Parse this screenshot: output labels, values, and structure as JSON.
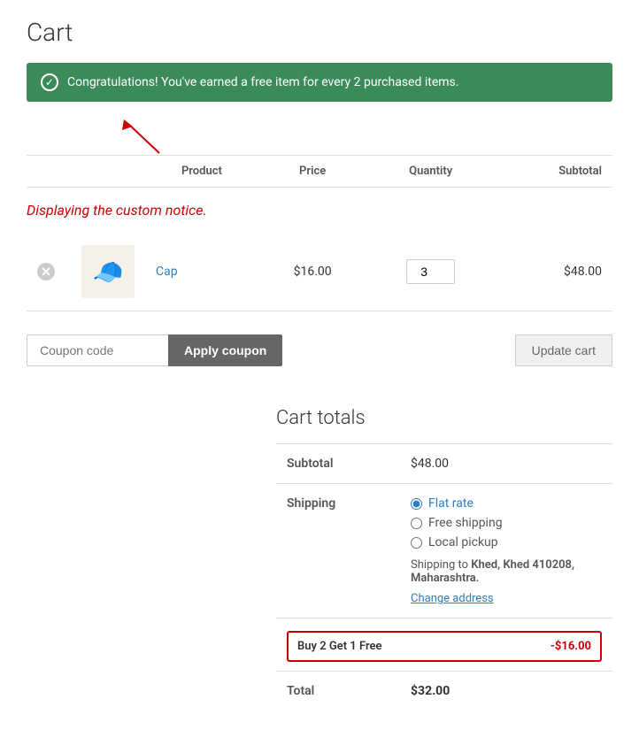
{
  "page": {
    "title": "Cart"
  },
  "notice": {
    "message": "Congratulations! You've earned a free item for every 2 purchased items.",
    "icon": "✓"
  },
  "custom_notice": "Displaying the custom notice.",
  "table": {
    "headers": [
      "",
      "",
      "Product",
      "Price",
      "Quantity",
      "Subtotal"
    ],
    "rows": [
      {
        "product_name": "Cap",
        "price": "$16.00",
        "quantity": 3,
        "subtotal": "$48.00",
        "thumb_emoji": "🧢"
      }
    ]
  },
  "coupon": {
    "placeholder": "Coupon code",
    "apply_label": "Apply coupon",
    "update_label": "Update cart"
  },
  "cart_totals": {
    "title": "Cart totals",
    "subtotal_label": "Subtotal",
    "subtotal_value": "$48.00",
    "shipping_label": "Shipping",
    "shipping_options": [
      {
        "label": "Flat rate",
        "selected": true
      },
      {
        "label": "Free shipping",
        "selected": false
      },
      {
        "label": "Local pickup",
        "selected": false
      }
    ],
    "shipping_to_text": "Shipping to",
    "shipping_location": "Khed, Khed 410208, Maharashtra.",
    "change_address": "Change address",
    "discount_label": "Buy 2 Get 1 Free",
    "discount_value": "-$16.00",
    "total_label": "Total",
    "total_value": "$32.00"
  }
}
